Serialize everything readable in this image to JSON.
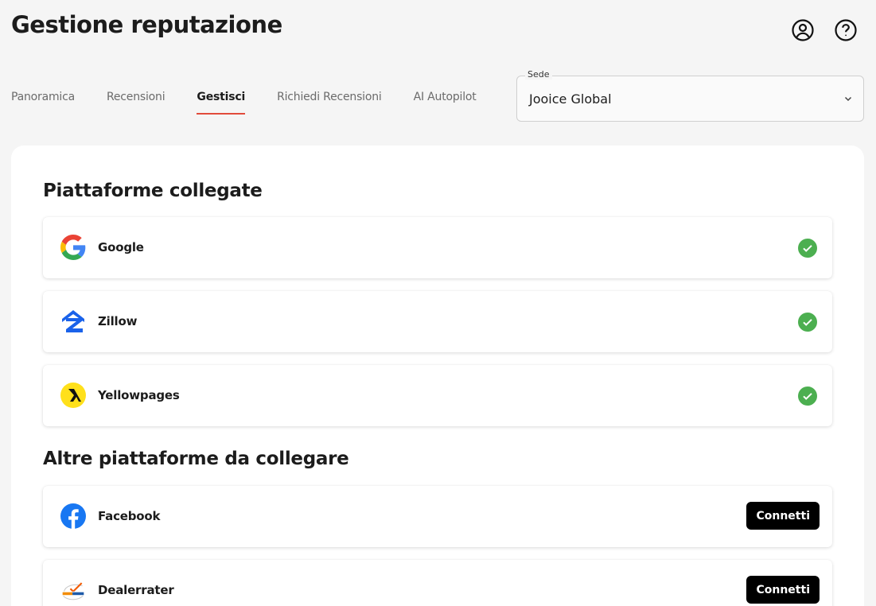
{
  "header": {
    "title": "Gestione reputazione",
    "icons": [
      "user-circle-icon",
      "help-circle-icon"
    ]
  },
  "tabs": [
    {
      "label": "Panoramica",
      "active": false
    },
    {
      "label": "Recensioni",
      "active": false
    },
    {
      "label": "Gestisci",
      "active": true
    },
    {
      "label": "Richiedi Recensioni",
      "active": false
    },
    {
      "label": "AI Autopilot",
      "active": false
    }
  ],
  "location": {
    "label": "Sede",
    "value": "Jooice Global"
  },
  "connected": {
    "title": "Piattaforme collegate",
    "items": [
      {
        "name": "Google",
        "icon": "google-logo-icon",
        "status": "connected"
      },
      {
        "name": "Zillow",
        "icon": "zillow-logo-icon",
        "status": "connected"
      },
      {
        "name": "Yellowpages",
        "icon": "yellowpages-logo-icon",
        "status": "connected"
      }
    ]
  },
  "available": {
    "title": "Altre piattaforme da collegare",
    "connect_label": "Connetti",
    "items": [
      {
        "name": "Facebook",
        "icon": "facebook-logo-icon"
      },
      {
        "name": "Dealerrater",
        "icon": "dealerrater-logo-icon"
      }
    ]
  },
  "colors": {
    "accent": "#e14b3b",
    "success": "#4caf50",
    "button": "#000000"
  }
}
